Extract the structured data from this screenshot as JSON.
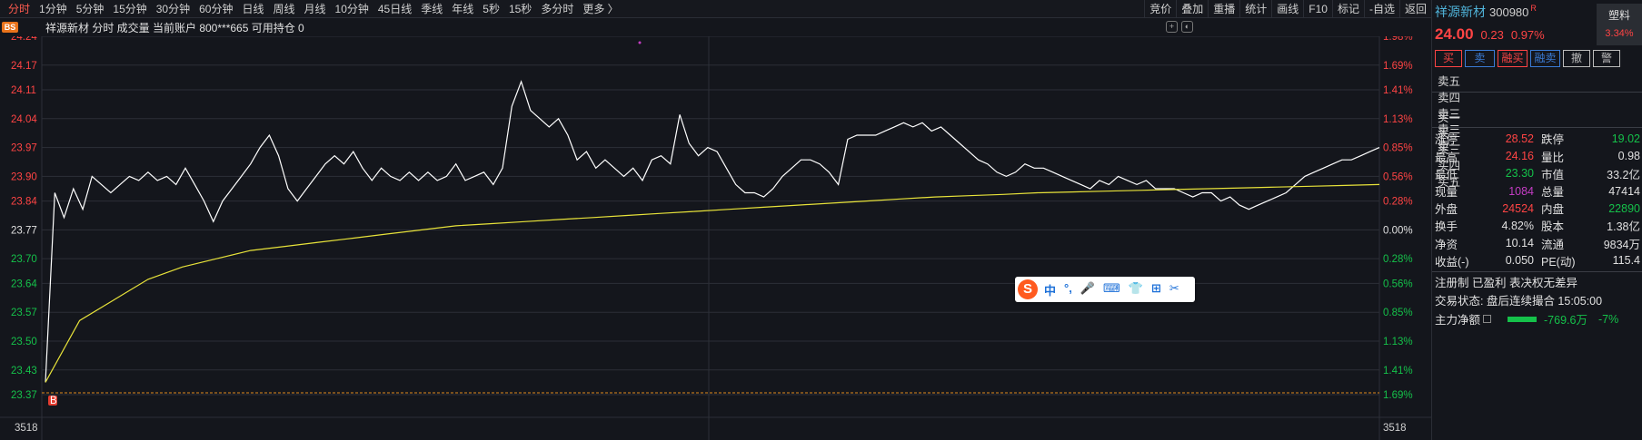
{
  "toolbar": {
    "periods": [
      "分时",
      "1分钟",
      "5分钟",
      "15分钟",
      "30分钟",
      "60分钟",
      "日线",
      "周线",
      "月线",
      "10分钟",
      "45日线",
      "季线",
      "年线",
      "5秒",
      "15秒",
      "多分时",
      "更多 〉"
    ],
    "tools": [
      "竞价",
      "叠加",
      "重播",
      "统计",
      "画线",
      "F10",
      "标记",
      "-自选",
      "返回"
    ]
  },
  "info": {
    "badge": "BS",
    "text": "祥源新材   分时 成交量 当前账户  800***665  可用持仓  0"
  },
  "chart_data": {
    "type": "line",
    "prev_close": 23.77,
    "ylim": [
      23.37,
      24.24
    ],
    "left_ticks": [
      "24.24",
      "24.17",
      "24.11",
      "24.04",
      "23.97",
      "23.90",
      "23.84",
      "23.77",
      "23.70",
      "23.64",
      "23.57",
      "23.50",
      "23.43",
      "23.37"
    ],
    "right_ticks": [
      "1.98%",
      "1.69%",
      "1.41%",
      "1.13%",
      "0.85%",
      "0.56%",
      "0.28%",
      "0.00%",
      "0.28%",
      "0.56%",
      "0.85%",
      "1.13%",
      "1.41%",
      "1.69%"
    ],
    "volume_label": "3518",
    "series": [
      {
        "color": "#ffffff",
        "values": [
          23.4,
          23.86,
          23.8,
          23.87,
          23.82,
          23.9,
          23.88,
          23.86,
          23.88,
          23.9,
          23.89,
          23.91,
          23.89,
          23.9,
          23.88,
          23.92,
          23.88,
          23.84,
          23.79,
          23.84,
          23.87,
          23.9,
          23.93,
          23.97,
          24.0,
          23.95,
          23.87,
          23.84,
          23.87,
          23.9,
          23.93,
          23.95,
          23.93,
          23.96,
          23.92,
          23.89,
          23.92,
          23.9,
          23.89,
          23.91,
          23.89,
          23.91,
          23.89,
          23.9,
          23.93,
          23.89,
          23.9,
          23.91,
          23.88,
          23.92,
          24.07,
          24.13,
          24.06,
          24.04,
          24.02,
          24.04,
          24.0,
          23.94,
          23.96,
          23.92,
          23.94,
          23.92,
          23.9,
          23.92,
          23.89,
          23.94,
          23.95,
          23.93,
          24.05,
          23.98,
          23.95,
          23.97,
          23.96,
          23.92,
          23.88,
          23.86,
          23.86,
          23.85,
          23.87,
          23.9,
          23.92,
          23.94,
          23.94,
          23.93,
          23.91,
          23.88,
          23.99,
          24.0,
          24.0,
          24.0,
          24.01,
          24.02,
          24.03,
          24.02,
          24.03,
          24.01,
          24.02,
          24.0,
          23.98,
          23.96,
          23.94,
          23.93,
          23.91,
          23.9,
          23.91,
          23.93,
          23.92,
          23.92,
          23.91,
          23.9,
          23.89,
          23.88,
          23.87,
          23.89,
          23.88,
          23.9,
          23.89,
          23.88,
          23.89,
          23.87,
          23.87,
          23.87,
          23.86,
          23.85,
          23.86,
          23.86,
          23.84,
          23.85,
          23.83,
          23.82,
          23.83,
          23.84,
          23.85,
          23.86,
          23.88,
          23.9,
          23.91,
          23.92,
          23.93,
          23.94,
          23.94,
          23.95,
          23.96,
          23.97
        ]
      },
      {
        "color": "#e8e33a",
        "values": [
          23.4,
          23.55,
          23.6,
          23.65,
          23.68,
          23.7,
          23.72,
          23.73,
          23.74,
          23.75,
          23.76,
          23.77,
          23.78,
          23.785,
          23.79,
          23.795,
          23.8,
          23.805,
          23.81,
          23.815,
          23.82,
          23.825,
          23.83,
          23.835,
          23.84,
          23.845,
          23.85,
          23.853,
          23.856,
          23.86,
          23.862,
          23.864,
          23.866,
          23.868,
          23.87,
          23.872,
          23.874,
          23.876,
          23.878,
          23.88
        ]
      }
    ],
    "sell_marker": "B"
  },
  "sogou": {
    "logo": "S",
    "icons": [
      "中",
      "°,",
      "🎤",
      "⌨",
      "👕",
      "⊞",
      "✂"
    ]
  },
  "quote": {
    "name": "祥源新材",
    "code": "300980",
    "r": "R",
    "price": "24.00",
    "change": "0.23",
    "pct": "0.97%",
    "tag": "塑料",
    "tag_pct": "3.34%",
    "buttons": [
      {
        "t": "买",
        "c": "#ff4444"
      },
      {
        "t": "卖",
        "c": "#3a7bd5"
      },
      {
        "t": "融买",
        "c": "#ff4444"
      },
      {
        "t": "融卖",
        "c": "#3a7bd5"
      },
      {
        "t": "撤",
        "c": "#bbbbbb"
      },
      {
        "t": "警",
        "c": "#bbbbbb"
      }
    ],
    "sell": [
      "卖五",
      "卖四",
      "卖三",
      "卖二",
      "卖一"
    ],
    "buy": [
      "买一",
      "买二",
      "买三",
      "买四",
      "买五"
    ],
    "stats": [
      [
        "涨停",
        "28.52",
        "red",
        "跌停",
        "19.02",
        "green"
      ],
      [
        "最高",
        "24.16",
        "red",
        "量比",
        "0.98",
        "white"
      ],
      [
        "最低",
        "23.30",
        "green",
        "市值",
        "33.2亿",
        "white"
      ],
      [
        "现量",
        "1084",
        "purple",
        "总量",
        "47414",
        "white"
      ],
      [
        "外盘",
        "24524",
        "red",
        "内盘",
        "22890",
        "green"
      ],
      [
        "换手",
        "4.82%",
        "white",
        "股本",
        "1.38亿",
        "white"
      ],
      [
        "净资",
        "10.14",
        "white",
        "流通",
        "9834万",
        "white"
      ],
      [
        "收益(-)",
        "0.050",
        "white",
        "PE(动)",
        "115.4",
        "white"
      ]
    ],
    "note1": "注册制 已盈利 表决权无差异",
    "note2": "交易状态: 盘后连续撮合 15:05:00",
    "flow_label": "主力净额",
    "flow_val": "-769.6万",
    "flow_pct": "-7%"
  }
}
